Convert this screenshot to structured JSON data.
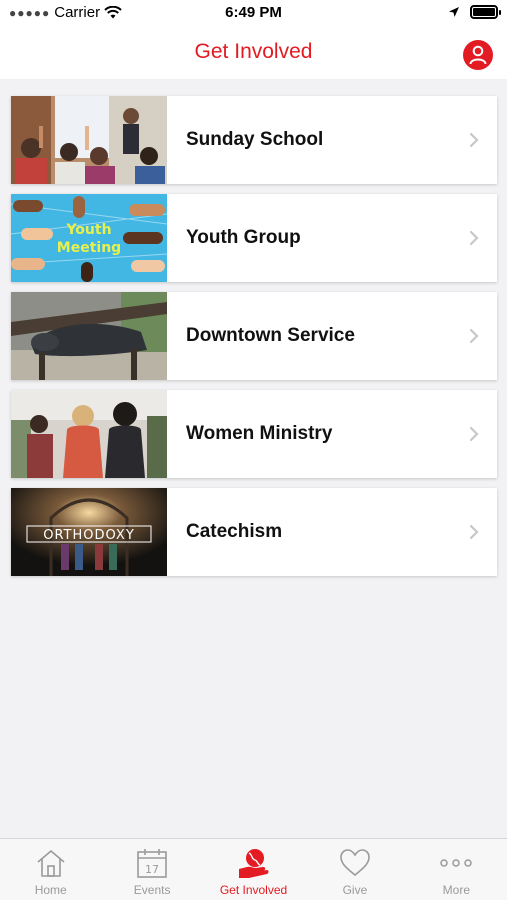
{
  "status_bar": {
    "carrier": "Carrier",
    "time": "6:49 PM"
  },
  "nav": {
    "title": "Get Involved",
    "profile_icon": "person-icon"
  },
  "colors": {
    "accent": "#e31b23",
    "chevron": "#c7c7cc",
    "tab_inactive": "#9a9a9a"
  },
  "items": [
    {
      "label": "Sunday School",
      "image": "children-classroom-photo"
    },
    {
      "label": "Youth Group",
      "image": "youth-meeting-graphic"
    },
    {
      "label": "Downtown Service",
      "image": "person-on-bench-photo"
    },
    {
      "label": "Women Ministry",
      "image": "women-gathering-photo"
    },
    {
      "label": "Catechism",
      "image": "orthodoxy-cathedral-photo",
      "image_text": "ORTHODOXY"
    }
  ],
  "tabs": [
    {
      "label": "Home",
      "icon": "house-icon",
      "active": false
    },
    {
      "label": "Events",
      "icon": "calendar-icon",
      "icon_text": "17",
      "active": false
    },
    {
      "label": "Get Involved",
      "icon": "hand-globe-icon",
      "active": true
    },
    {
      "label": "Give",
      "icon": "heart-icon",
      "active": false
    },
    {
      "label": "More",
      "icon": "more-dots-icon",
      "active": false
    }
  ]
}
